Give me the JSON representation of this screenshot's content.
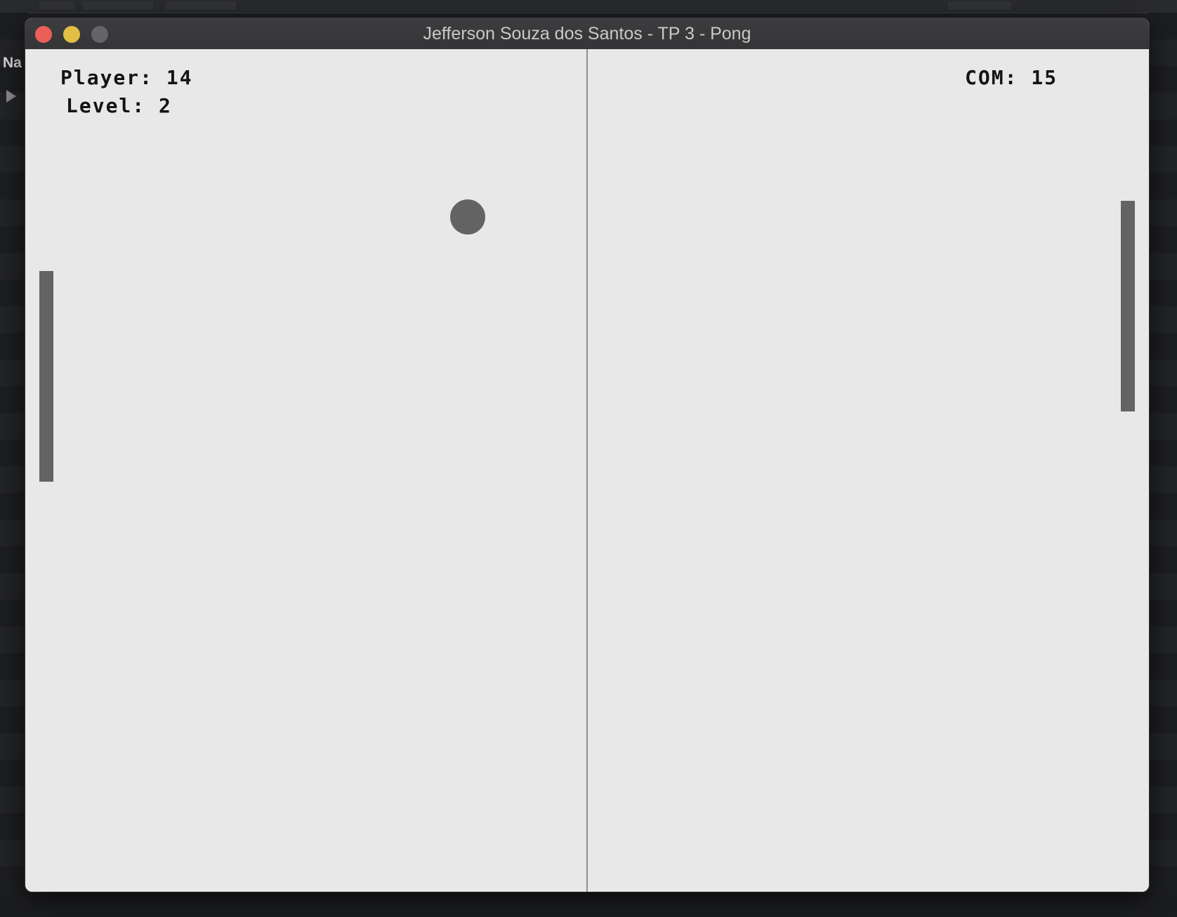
{
  "background": {
    "nav_label": "Na",
    "play_icon": "play-triangle-icon"
  },
  "window": {
    "title": "Jefferson Souza dos Santos - TP 3 - Pong",
    "controls": {
      "close": "close-icon",
      "minimize": "minimize-icon",
      "zoom": "zoom-icon"
    }
  },
  "hud": {
    "player_score": "Player: 14",
    "level": "Level: 2",
    "com_score": "COM: 15"
  },
  "colors": {
    "field_bg": "#e8e8e8",
    "paddle": "#636363",
    "ball": "#636363",
    "center_line": "#8e8e8e",
    "text": "#141414",
    "close": "#ec5f57",
    "minimize": "#e2be44",
    "zoom": "#656567"
  }
}
